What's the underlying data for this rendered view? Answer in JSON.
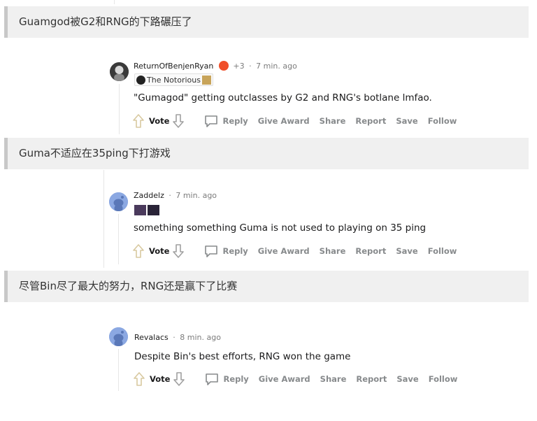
{
  "translations": [
    "Guamgod被G2和RNG的下路碾压了",
    "Guma不适应在35ping下打游戏",
    "尽管Bin尽了最大的努力，RNG还是赢下了比赛"
  ],
  "comments": [
    {
      "username": "ReturnOfBenjenRyan",
      "award_count": "+3",
      "time": "7 min. ago",
      "flair_text": "The Notorious",
      "body": "\"Gumagod\" getting outclasses by G2 and RNG's botlane lmfao."
    },
    {
      "username": "Zaddelz",
      "time": "7 min. ago",
      "body": "something something Guma is not used to playing on 35 ping"
    },
    {
      "username": "Revalacs",
      "time": "8 min. ago",
      "body": "Despite Bin's best efforts, RNG won the game"
    }
  ],
  "actions": {
    "vote": "Vote",
    "reply": "Reply",
    "give_award": "Give Award",
    "share": "Share",
    "report": "Report",
    "save": "Save",
    "follow": "Follow"
  },
  "colors": {
    "banner_bg": "#f0f0f0",
    "banner_accent": "#c8c8c8",
    "muted": "#878a8c",
    "text": "#1a1a1b"
  }
}
